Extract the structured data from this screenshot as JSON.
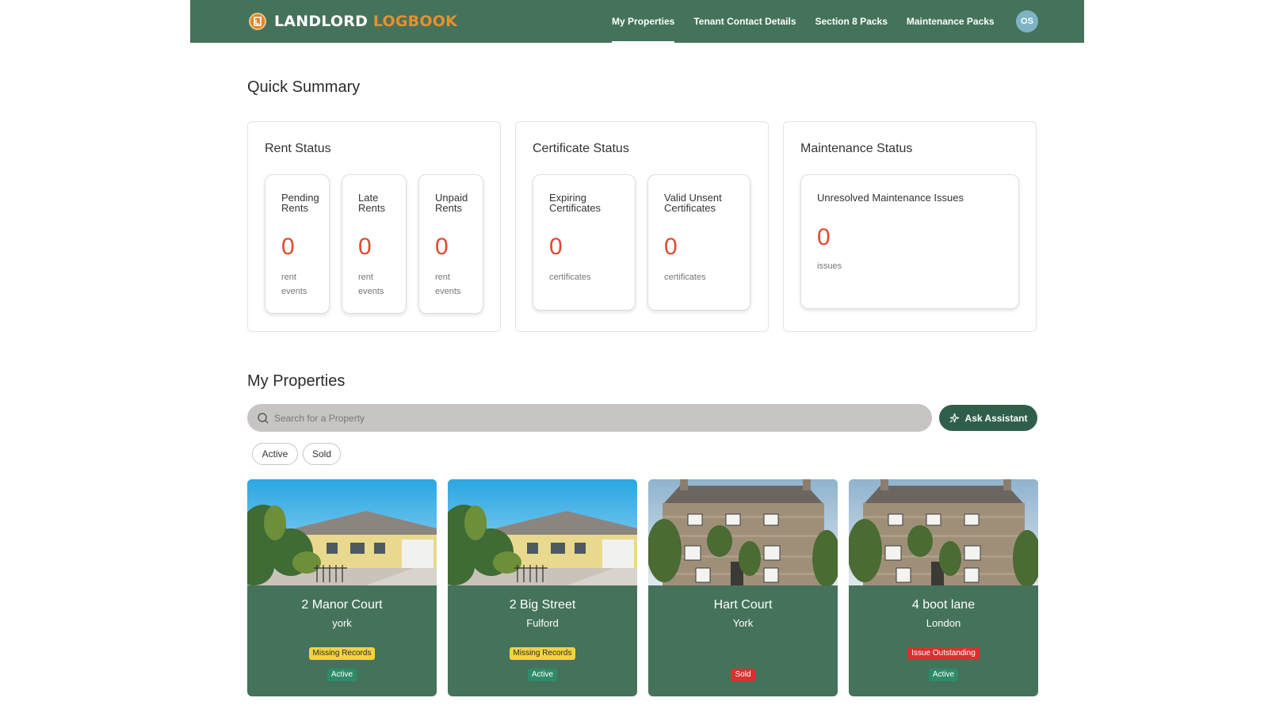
{
  "brand": {
    "part1": "LANDLORD",
    "part2": "LOGBOOK"
  },
  "nav": {
    "items": [
      {
        "label": "My Properties",
        "active": true
      },
      {
        "label": "Tenant Contact Details",
        "active": false
      },
      {
        "label": "Section 8 Packs",
        "active": false
      },
      {
        "label": "Maintenance Packs",
        "active": false
      }
    ],
    "avatar": "OS"
  },
  "summary": {
    "title": "Quick Summary",
    "rent": {
      "title": "Rent Status",
      "metrics": [
        {
          "label_line1": "Pending",
          "label_line2": "Rents",
          "value": "0",
          "unit_line1": "rent",
          "unit_line2": "events"
        },
        {
          "label_line1": "Late",
          "label_line2": "Rents",
          "value": "0",
          "unit_line1": "rent",
          "unit_line2": "events"
        },
        {
          "label_line1": "Unpaid",
          "label_line2": "Rents",
          "value": "0",
          "unit_line1": "rent",
          "unit_line2": "events"
        }
      ]
    },
    "certificate": {
      "title": "Certificate Status",
      "metrics": [
        {
          "label_line1": "Expiring",
          "label_line2": "Certificates",
          "value": "0",
          "unit": "certificates"
        },
        {
          "label_line1": "Valid Unsent",
          "label_line2": "Certificates",
          "value": "0",
          "unit": "certificates"
        }
      ]
    },
    "maintenance": {
      "title": "Maintenance Status",
      "metrics": [
        {
          "label": "Unresolved Maintenance Issues",
          "value": "0",
          "unit": "issues"
        }
      ]
    }
  },
  "properties": {
    "title": "My Properties",
    "search_placeholder": "Search for a Property",
    "assistant_label": "Ask Assistant",
    "filters": [
      "Active",
      "Sold"
    ],
    "cards": [
      {
        "name": "2 Manor Court",
        "city": "york",
        "badge1": "Missing Records",
        "badge1_color": "#f3d33a",
        "status": "Active",
        "status_color": "#2e8b6a",
        "image": "bungalow"
      },
      {
        "name": "2 Big Street",
        "city": "Fulford",
        "badge1": "Missing Records",
        "badge1_color": "#f3d33a",
        "status": "Active",
        "status_color": "#2e8b6a",
        "image": "bungalow"
      },
      {
        "name": "Hart Court",
        "city": "York",
        "badge1": "",
        "status": "Sold",
        "status_color": "#d93030",
        "image": "stone-cottage"
      },
      {
        "name": "4 boot lane",
        "city": "London",
        "badge1": "Issue Outstanding",
        "badge1_color": "#d93030",
        "status": "Active",
        "status_color": "#2e8b6a",
        "image": "stone-cottage"
      }
    ]
  },
  "colors": {
    "brand_green": "#45725b",
    "accent_orange": "#e8902e",
    "metric_red": "#e04a2f",
    "assistant_green": "#2f5f4a"
  }
}
